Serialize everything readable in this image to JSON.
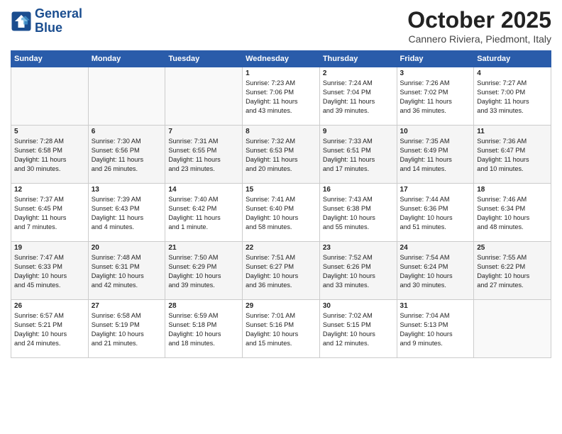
{
  "header": {
    "logo_line1": "General",
    "logo_line2": "Blue",
    "month": "October 2025",
    "location": "Cannero Riviera, Piedmont, Italy"
  },
  "days_of_week": [
    "Sunday",
    "Monday",
    "Tuesday",
    "Wednesday",
    "Thursday",
    "Friday",
    "Saturday"
  ],
  "weeks": [
    [
      {
        "day": "",
        "info": ""
      },
      {
        "day": "",
        "info": ""
      },
      {
        "day": "",
        "info": ""
      },
      {
        "day": "1",
        "info": "Sunrise: 7:23 AM\nSunset: 7:06 PM\nDaylight: 11 hours\nand 43 minutes."
      },
      {
        "day": "2",
        "info": "Sunrise: 7:24 AM\nSunset: 7:04 PM\nDaylight: 11 hours\nand 39 minutes."
      },
      {
        "day": "3",
        "info": "Sunrise: 7:26 AM\nSunset: 7:02 PM\nDaylight: 11 hours\nand 36 minutes."
      },
      {
        "day": "4",
        "info": "Sunrise: 7:27 AM\nSunset: 7:00 PM\nDaylight: 11 hours\nand 33 minutes."
      }
    ],
    [
      {
        "day": "5",
        "info": "Sunrise: 7:28 AM\nSunset: 6:58 PM\nDaylight: 11 hours\nand 30 minutes."
      },
      {
        "day": "6",
        "info": "Sunrise: 7:30 AM\nSunset: 6:56 PM\nDaylight: 11 hours\nand 26 minutes."
      },
      {
        "day": "7",
        "info": "Sunrise: 7:31 AM\nSunset: 6:55 PM\nDaylight: 11 hours\nand 23 minutes."
      },
      {
        "day": "8",
        "info": "Sunrise: 7:32 AM\nSunset: 6:53 PM\nDaylight: 11 hours\nand 20 minutes."
      },
      {
        "day": "9",
        "info": "Sunrise: 7:33 AM\nSunset: 6:51 PM\nDaylight: 11 hours\nand 17 minutes."
      },
      {
        "day": "10",
        "info": "Sunrise: 7:35 AM\nSunset: 6:49 PM\nDaylight: 11 hours\nand 14 minutes."
      },
      {
        "day": "11",
        "info": "Sunrise: 7:36 AM\nSunset: 6:47 PM\nDaylight: 11 hours\nand 10 minutes."
      }
    ],
    [
      {
        "day": "12",
        "info": "Sunrise: 7:37 AM\nSunset: 6:45 PM\nDaylight: 11 hours\nand 7 minutes."
      },
      {
        "day": "13",
        "info": "Sunrise: 7:39 AM\nSunset: 6:43 PM\nDaylight: 11 hours\nand 4 minutes."
      },
      {
        "day": "14",
        "info": "Sunrise: 7:40 AM\nSunset: 6:42 PM\nDaylight: 11 hours\nand 1 minute."
      },
      {
        "day": "15",
        "info": "Sunrise: 7:41 AM\nSunset: 6:40 PM\nDaylight: 10 hours\nand 58 minutes."
      },
      {
        "day": "16",
        "info": "Sunrise: 7:43 AM\nSunset: 6:38 PM\nDaylight: 10 hours\nand 55 minutes."
      },
      {
        "day": "17",
        "info": "Sunrise: 7:44 AM\nSunset: 6:36 PM\nDaylight: 10 hours\nand 51 minutes."
      },
      {
        "day": "18",
        "info": "Sunrise: 7:46 AM\nSunset: 6:34 PM\nDaylight: 10 hours\nand 48 minutes."
      }
    ],
    [
      {
        "day": "19",
        "info": "Sunrise: 7:47 AM\nSunset: 6:33 PM\nDaylight: 10 hours\nand 45 minutes."
      },
      {
        "day": "20",
        "info": "Sunrise: 7:48 AM\nSunset: 6:31 PM\nDaylight: 10 hours\nand 42 minutes."
      },
      {
        "day": "21",
        "info": "Sunrise: 7:50 AM\nSunset: 6:29 PM\nDaylight: 10 hours\nand 39 minutes."
      },
      {
        "day": "22",
        "info": "Sunrise: 7:51 AM\nSunset: 6:27 PM\nDaylight: 10 hours\nand 36 minutes."
      },
      {
        "day": "23",
        "info": "Sunrise: 7:52 AM\nSunset: 6:26 PM\nDaylight: 10 hours\nand 33 minutes."
      },
      {
        "day": "24",
        "info": "Sunrise: 7:54 AM\nSunset: 6:24 PM\nDaylight: 10 hours\nand 30 minutes."
      },
      {
        "day": "25",
        "info": "Sunrise: 7:55 AM\nSunset: 6:22 PM\nDaylight: 10 hours\nand 27 minutes."
      }
    ],
    [
      {
        "day": "26",
        "info": "Sunrise: 6:57 AM\nSunset: 5:21 PM\nDaylight: 10 hours\nand 24 minutes."
      },
      {
        "day": "27",
        "info": "Sunrise: 6:58 AM\nSunset: 5:19 PM\nDaylight: 10 hours\nand 21 minutes."
      },
      {
        "day": "28",
        "info": "Sunrise: 6:59 AM\nSunset: 5:18 PM\nDaylight: 10 hours\nand 18 minutes."
      },
      {
        "day": "29",
        "info": "Sunrise: 7:01 AM\nSunset: 5:16 PM\nDaylight: 10 hours\nand 15 minutes."
      },
      {
        "day": "30",
        "info": "Sunrise: 7:02 AM\nSunset: 5:15 PM\nDaylight: 10 hours\nand 12 minutes."
      },
      {
        "day": "31",
        "info": "Sunrise: 7:04 AM\nSunset: 5:13 PM\nDaylight: 10 hours\nand 9 minutes."
      },
      {
        "day": "",
        "info": ""
      }
    ]
  ]
}
